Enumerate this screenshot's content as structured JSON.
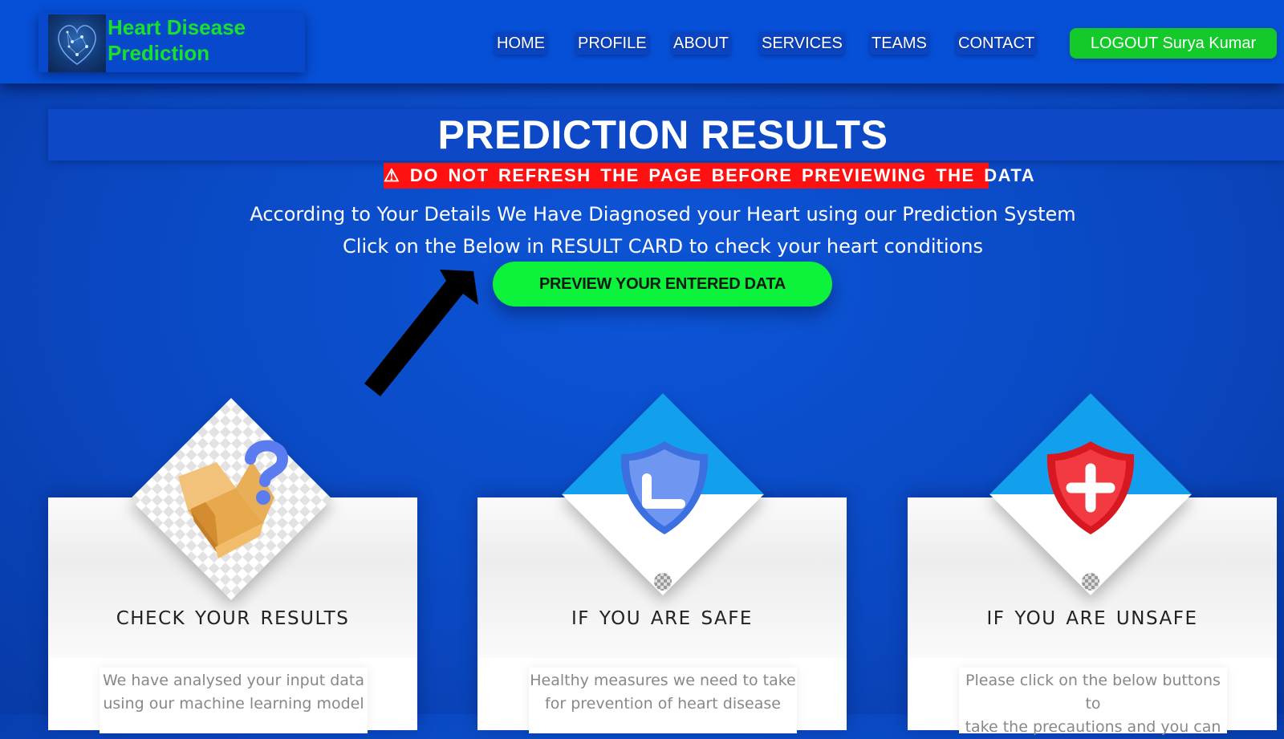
{
  "brand": {
    "title_line1": "Heart Disease",
    "title_line2": "Prediction",
    "logo_icon": "heart-logo-icon"
  },
  "nav": {
    "items": [
      {
        "label": "HOME"
      },
      {
        "label": "PROFILE"
      },
      {
        "label": "ABOUT"
      },
      {
        "label": "SERVICES"
      },
      {
        "label": "TEAMS"
      },
      {
        "label": "CONTACT"
      }
    ],
    "logout_label": "LOGOUT Surya Kumar"
  },
  "main": {
    "title": "PREDICTION RESULTS",
    "warning_icon": "⚠",
    "warning": "DO NOT REFRESH THE PAGE BEFORE PREVIEWING THE DATA",
    "desc_line1": "According to Your Details We Have Diagnosed your Heart using our Prediction System",
    "desc_line2": "Click on the Below in RESULT CARD to check your heart conditions",
    "preview_button": "PREVIEW YOUR ENTERED DATA"
  },
  "cards": [
    {
      "title": "CHECK YOUR RESULTS",
      "text_line1": "We have analysed your input data",
      "text_line2": "using our machine learning model",
      "icon": "open-box-question-icon"
    },
    {
      "title": "IF YOU ARE SAFE",
      "text_line1": "Healthy measures we need to take",
      "text_line2": "for prevention of heart disease",
      "icon": "blue-shield-check-icon"
    },
    {
      "title": "IF YOU ARE UNSAFE",
      "text_line1": "Please click on the below buttons to",
      "text_line2": "take the precautions and you can",
      "icon": "red-shield-plus-icon"
    }
  ],
  "colors": {
    "background": "#0a47c0",
    "header": "#0650d8",
    "brand_text": "#19e02b",
    "logout_button": "#14c92a",
    "preview_button": "#0df23a",
    "warning_bg": "#ff1111",
    "diamond_blue": "#12a0ee"
  }
}
